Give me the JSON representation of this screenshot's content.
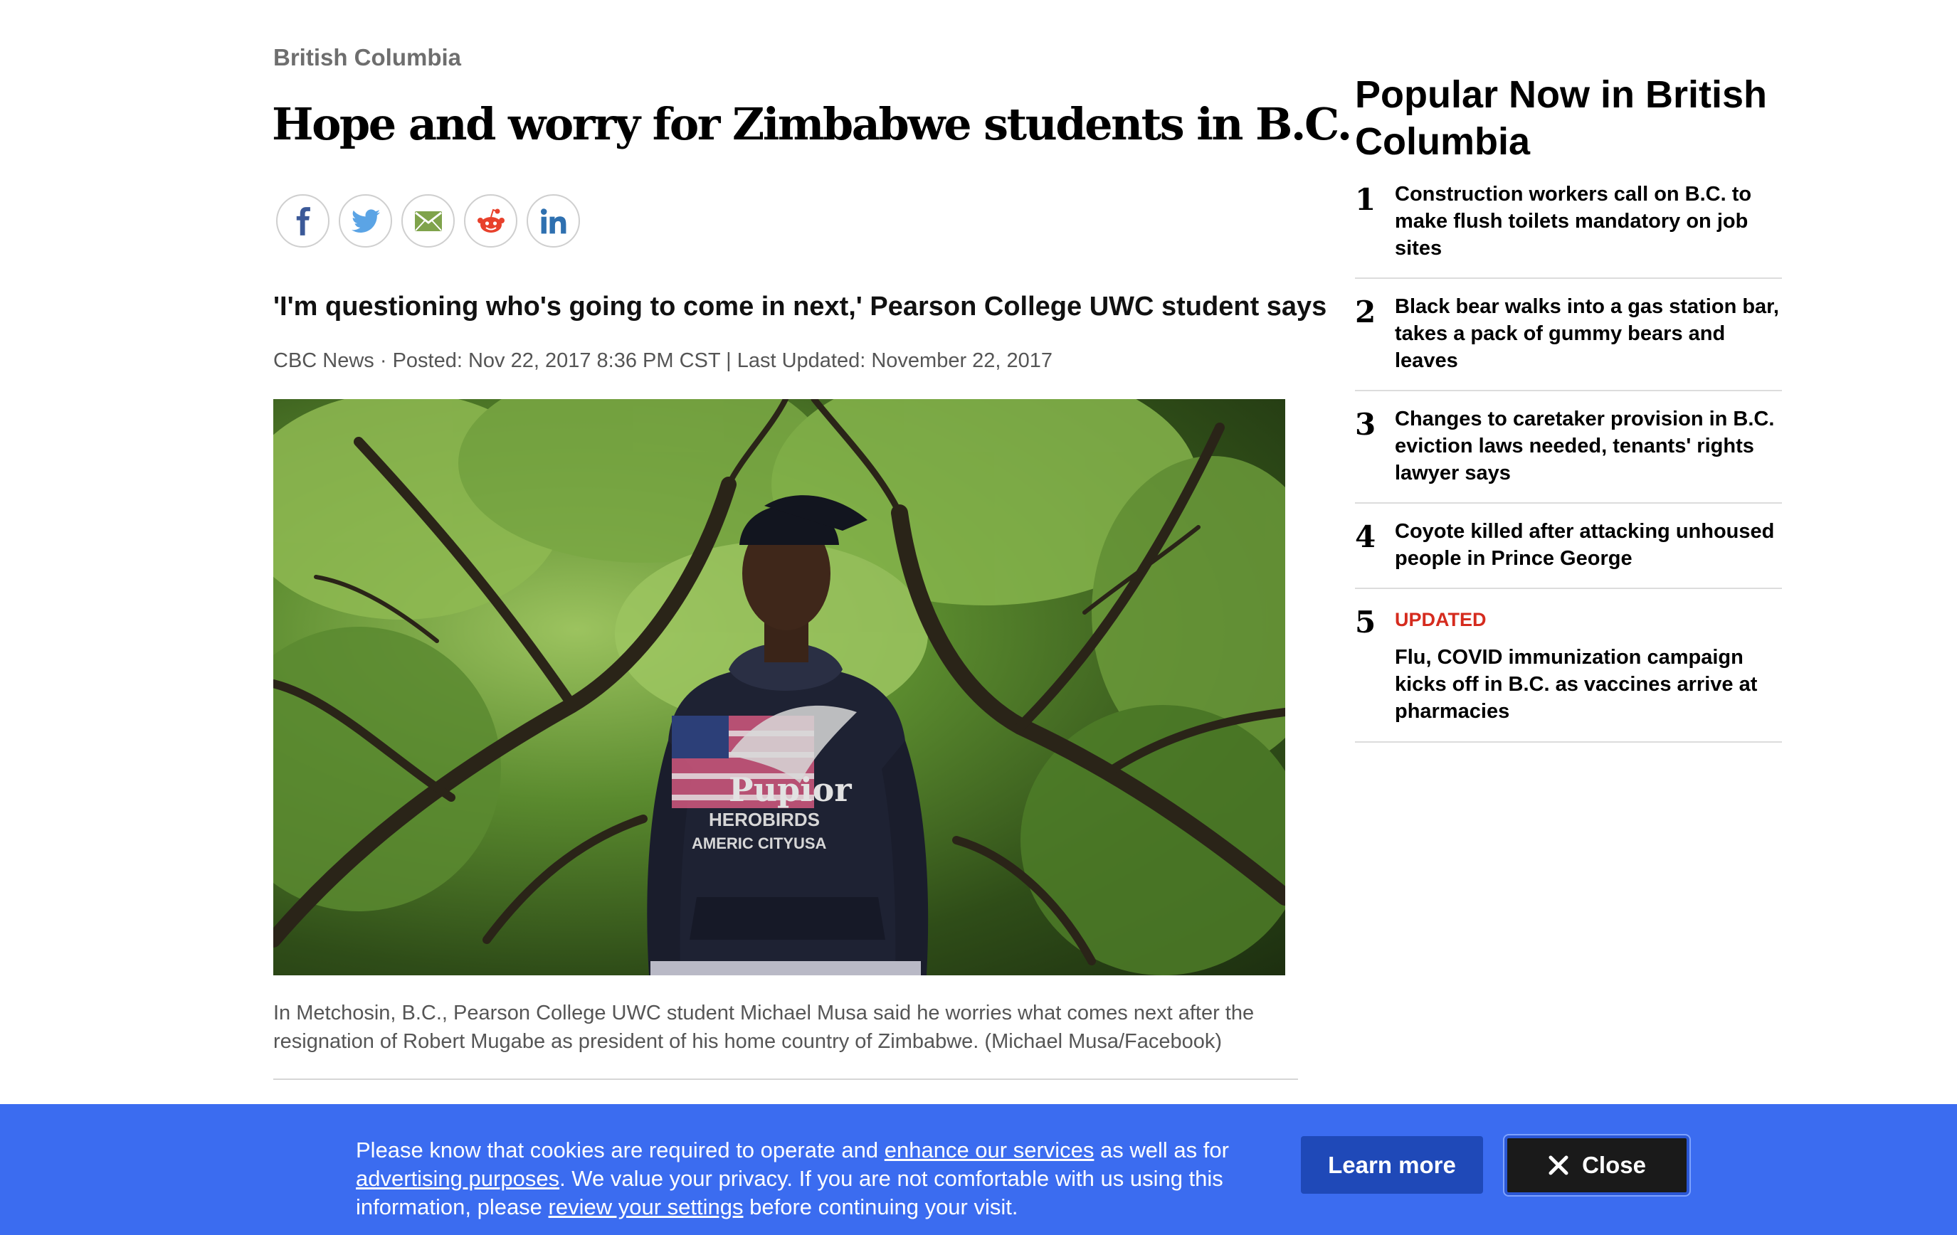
{
  "article": {
    "section": "British Columbia",
    "headline": "Hope and worry for Zimbabwe students in B.C.",
    "deck": "'I'm questioning who's going to come in next,' Pearson College UWC student says",
    "byline": "CBC News · Posted: Nov 22, 2017 8:36 PM CST | Last Updated: November 22, 2017",
    "photo_hoodie_text": [
      "HEROBIRDS",
      "AMERIC CITYUSA"
    ],
    "caption": "In Metchosin, B.C., Pearson College UWC student Michael Musa said he worries what comes next after the resignation of Robert Mugabe as president of his home country of Zimbabwe. (Michael Musa/Facebook)"
  },
  "share": {
    "buttons": [
      {
        "icon": "facebook-icon",
        "color": "#3b5998"
      },
      {
        "icon": "twitter-icon",
        "color": "#5ba4e5"
      },
      {
        "icon": "email-icon",
        "color": "#6a8f3a"
      },
      {
        "icon": "reddit-icon",
        "color": "#e8412c"
      },
      {
        "icon": "linkedin-icon",
        "color": "#2e70b0"
      }
    ]
  },
  "popular": {
    "title": "Popular Now in British Columbia",
    "items": [
      {
        "rank": "1",
        "flag": "",
        "text": "Construction workers call on B.C. to make flush toilets mandatory on job sites"
      },
      {
        "rank": "2",
        "flag": "",
        "text": "Black bear walks into a gas station bar, takes a pack of gummy bears and leaves"
      },
      {
        "rank": "3",
        "flag": "",
        "text": "Changes to caretaker provision in B.C. eviction laws needed, tenants' rights lawyer says"
      },
      {
        "rank": "4",
        "flag": "",
        "text": "Coyote killed after attacking unhoused people in Prince George"
      },
      {
        "rank": "5",
        "flag": "UPDATED",
        "text": "Flu, COVID immunization campaign kicks off in B.C. as vaccines arrive at pharmacies"
      }
    ]
  },
  "cookie": {
    "t1": "Please know that cookies are required to operate and ",
    "link1": "enhance our services",
    "t2": " as well as for ",
    "link2": "advertising purposes",
    "t3": ". We value your privacy. If you are not comfortable with us using this information, please ",
    "link3": "review your settings",
    "t4": " before continuing your visit.",
    "learn_more": "Learn more",
    "close": "Close"
  },
  "colors": {
    "banner_bg": "#3b6cf0",
    "learn_bg": "#1f49b8",
    "close_bg": "#1a1a1a",
    "updated_flag": "#d52b1e"
  }
}
